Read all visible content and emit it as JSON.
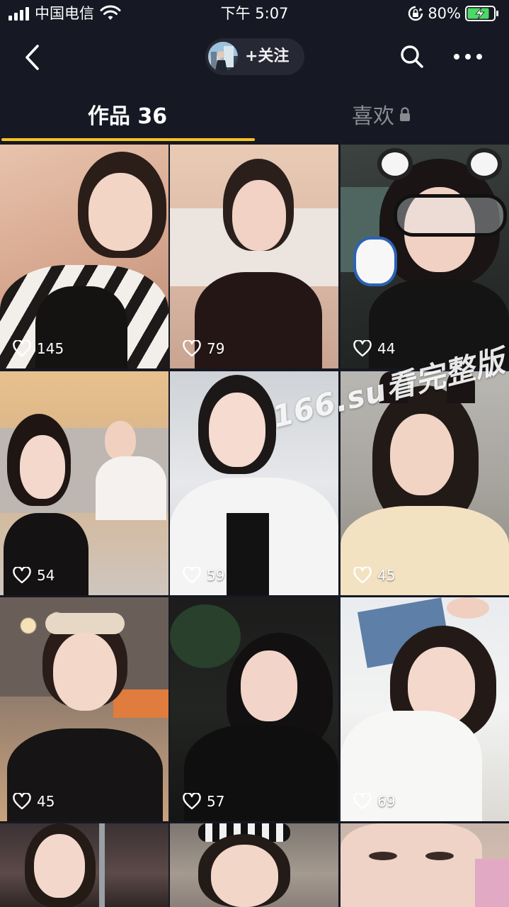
{
  "status_bar": {
    "carrier": "中国电信",
    "time": "下午 5:07",
    "battery_percent": "80%"
  },
  "nav": {
    "follow_label": "+关注",
    "icons": [
      "back-icon",
      "avatar",
      "search-icon",
      "more-icon"
    ]
  },
  "tabs": {
    "works_label": "作品 36",
    "likes_label": "喜欢",
    "likes_private_icon": "lock-icon"
  },
  "colors": {
    "background": "#161823",
    "tab_indicator": "#fcc41c",
    "pill": "#262834"
  },
  "watermark": "166.su看完整版",
  "videos": [
    {
      "likes": "145"
    },
    {
      "likes": "79"
    },
    {
      "likes": "44"
    },
    {
      "likes": "54"
    },
    {
      "likes": "59"
    },
    {
      "likes": "45"
    },
    {
      "likes": "45"
    },
    {
      "likes": "57"
    },
    {
      "likes": "69"
    },
    {
      "likes": ""
    },
    {
      "likes": ""
    },
    {
      "likes": ""
    }
  ]
}
